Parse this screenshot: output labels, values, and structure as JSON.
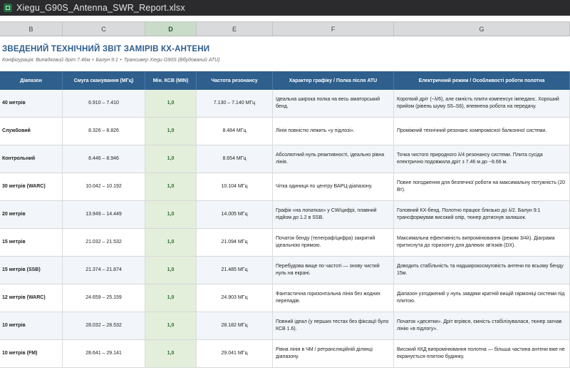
{
  "window": {
    "filename": "Xiegu_G90S_Antenna_SWR_Report.xlsx"
  },
  "column_headers": [
    "B",
    "C",
    "D",
    "E",
    "F",
    "G"
  ],
  "report": {
    "title": "ЗВЕДЕНИЙ ТЕХНІЧНИЙ ЗВІТ ЗАМІРІВ КХ-АНТЕНИ",
    "subtitle": "Конфігурація: Випадковий дріт 7.46м + Балун 9:1 + Трансивер Xiegu G90S (Вбудований ATU)"
  },
  "table": {
    "headers": [
      "Діапазон",
      "Смуга сканування (МГц)",
      "Мін. КСВ (MIN)",
      "Частота резонансу",
      "Характер графіку / Полка після ATU",
      "Електричний режим / Особливості роботи полотна"
    ],
    "rows": [
      {
        "band": "40 метрів",
        "range": "6.910 – 7.410",
        "swr": "1,0",
        "freq": "7.130 – 7.140 МГц",
        "graph": "Ідеальна широка полка на весь аматорський бенд.",
        "mode": "Короткий дріт (~λ/6), але ємність плити компенсує імпеданс. Хороший прийом (рівень шуму S5–S6), впевнена робота на передачу."
      },
      {
        "band": "Службовий",
        "range": "8.326 – 8.826",
        "swr": "1,0",
        "freq": "8.484 МГц",
        "graph": "Лінія повністю лежить «у підлозі».",
        "mode": "Проміжний технічний резонанс компромісної балконної системи."
      },
      {
        "band": "Контрольний",
        "range": "8.446 – 8.946",
        "swr": "1,0",
        "freq": "8.654 МГц",
        "graph": "Абсолютний нуль реактивності, ідеально рівна лінія.",
        "mode": "Точка чистого природного λ/4 резонансу системи. Плита сусіда електрично подовжила дріт з 7.46 м до ~8.66 м."
      },
      {
        "band": "30 метрів (WARC)",
        "range": "10.042 – 10.192",
        "swr": "1,0",
        "freq": "10.104 МГц",
        "graph": "Чітка одиниця по центру ВАРЦ-діапазону.",
        "mode": "Повне погодження для безпечної роботи на максимальну потужність (20 Вт)."
      },
      {
        "band": "20 метрів",
        "range": "13.949 – 14.449",
        "swr": "1,0",
        "freq": "14.005 МГц",
        "graph": "Графік «на лопатках» у CW/цифрі, плавний підйом до 1.2 в SSB.",
        "mode": "Головний КХ-бенд. Полотно працює близько до λ/2. Балун 9:1 трансформував високий опір, тюнер дотиснув залишок."
      },
      {
        "band": "15 метрів",
        "range": "21.032 – 21.532",
        "swr": "1,0",
        "freq": "21.094 МГц",
        "graph": "Початок бенду (телеграф/цифра) закритий ідеальною прямою.",
        "mode": "Максимальна ефективність випромінювання (режим 3/4λ). Діаграма притиснута до горизонту для далеких зв'язків (DX)."
      },
      {
        "band": "15 метрів (SSB)",
        "range": "21.374 – 21.874",
        "swr": "1,0",
        "freq": "21.485 МГц",
        "graph": "Перебудова вище по частоті — знову чистий нуль на екрані.",
        "mode": "Доводить стабільність та надширокосмуговість антени по всьому бенду 15м."
      },
      {
        "band": "12 метрів (WARC)",
        "range": "24.659 – 25.159",
        "swr": "1,0",
        "freq": "24.903 МГц",
        "graph": "Фантастична горизонтальна лінія без жодних перепадів.",
        "mode": "Діапазон узгоджений у нуль завдяки кратній вищій гармоніці системи під плитою."
      },
      {
        "band": "10 метрів",
        "range": "28.032 – 28.532",
        "swr": "1,0",
        "freq": "28.182 МГц",
        "graph": "Повний ідеал (у перших тестах без фіксації було КСВ 1.6).",
        "mode": "Початок «десятки». Дріт вгрівся, ємність стабілізувалася, тюнер загнав лінію «в підлогу»."
      },
      {
        "band": "10 метрів (FM)",
        "range": "28.641 – 29.141",
        "swr": "1,0",
        "freq": "29.041 МГц",
        "graph": "Рівна лінія в ЧМ / ретрансляційній ділянці діапазону.",
        "mode": "Високий ККД випромінювання полотна — більша частина антени вже не екранується плитою будинку."
      }
    ]
  }
}
